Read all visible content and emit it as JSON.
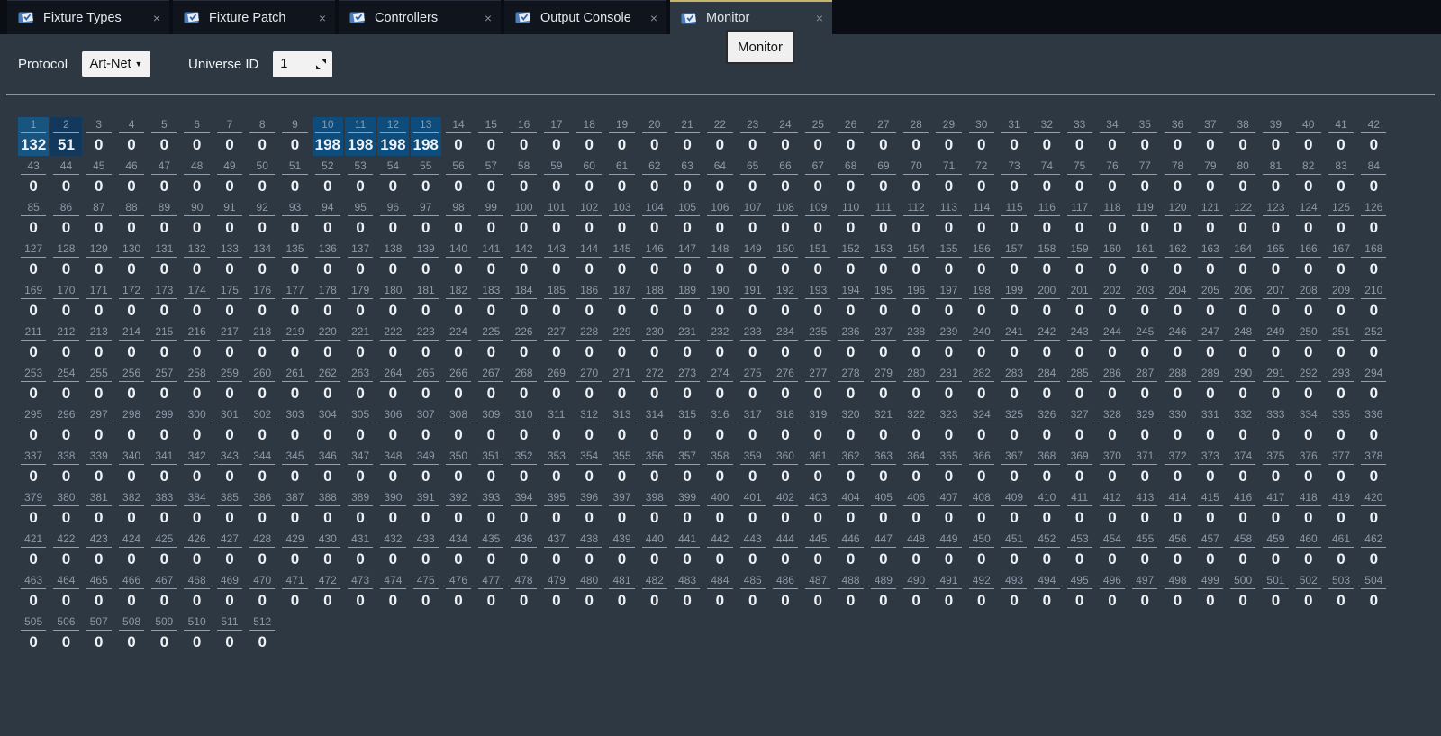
{
  "window": {
    "title": "Monitor"
  },
  "tabs": {
    "icon": "document-check-icon",
    "close_glyph": "×",
    "items": [
      {
        "label": "Fixture Types",
        "active": false
      },
      {
        "label": "Fixture Patch",
        "active": false
      },
      {
        "label": "Controllers",
        "active": false
      },
      {
        "label": "Output Console",
        "active": false
      },
      {
        "label": "Monitor",
        "active": true
      }
    ]
  },
  "tooltip": {
    "text": "Monitor"
  },
  "toolbar": {
    "protocol_label": "Protocol",
    "protocol_value": "Art-Net",
    "dropdown_glyph": "▼",
    "universe_label": "Universe ID",
    "universe_value": "1",
    "spin_icon": "diagonal-resize-icon"
  },
  "colors": {
    "page_bg": "#2d3843",
    "tabbar_bg": "#0a0e14",
    "active_tab_accent": "#c6b568",
    "highlight_mid": "#175480",
    "highlight_dim": "#12395c",
    "highlight_bright": "#0e4c7c",
    "value_text": "#eef2f6",
    "channel_number_text": "#8d99a7"
  },
  "grid": {
    "channel_count": 512,
    "columns": 42,
    "default_value": 0,
    "highlights": [
      {
        "channel": 1,
        "value": 132,
        "color": "#175480"
      },
      {
        "channel": 2,
        "value": 51,
        "color": "#12395c"
      },
      {
        "channel": 10,
        "value": 198,
        "color": "#0e4c7c"
      },
      {
        "channel": 11,
        "value": 198,
        "color": "#0e4c7c"
      },
      {
        "channel": 12,
        "value": 198,
        "color": "#0e4c7c"
      },
      {
        "channel": 13,
        "value": 198,
        "color": "#0e4c7c"
      }
    ]
  }
}
